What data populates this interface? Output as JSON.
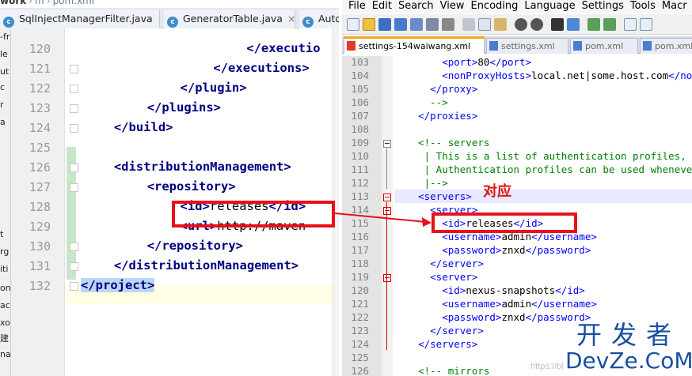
{
  "left": {
    "breadcrumb": [
      "work",
      "m",
      "pom.xml"
    ],
    "tabs": [
      "SqlInjectManagerFilter.java",
      "GeneratorTable.java",
      "Auto"
    ],
    "project_fragments": [
      "-fr",
      "le",
      "ut",
      "c",
      "r",
      "a",
      "t",
      "rg",
      "iti",
      "on",
      "ac",
      "xo",
      "建",
      "na"
    ],
    "line_numbers": [
      "120",
      "121",
      "122",
      "123",
      "124",
      "125",
      "126",
      "127",
      "128",
      "129",
      "130",
      "131",
      "132"
    ],
    "code_lines": [
      {
        "indent": 10,
        "text": "</executio",
        "kind": "tag"
      },
      {
        "indent": 8,
        "text": "</executions>",
        "kind": "tag"
      },
      {
        "indent": 6,
        "text": "</plugin>",
        "kind": "tag"
      },
      {
        "indent": 4,
        "text": "</plugins>",
        "kind": "tag"
      },
      {
        "indent": 2,
        "text": "</build>",
        "kind": "tag"
      },
      {
        "indent": 0,
        "text": "",
        "kind": "blank"
      },
      {
        "indent": 2,
        "text": "<distributionManagement>",
        "kind": "tag"
      },
      {
        "indent": 4,
        "text": "<repository>",
        "kind": "tag"
      },
      {
        "indent": 6,
        "open": "<id>",
        "value": "releases",
        "close": "</id>",
        "kind": "mixed"
      },
      {
        "indent": 6,
        "open": "<url>",
        "value": "http://maven",
        "close": "",
        "kind": "mixed"
      },
      {
        "indent": 4,
        "text": "</repository>",
        "kind": "tag"
      },
      {
        "indent": 2,
        "text": "</distributionManagement>",
        "kind": "tag"
      },
      {
        "indent": 0,
        "text": "</project>",
        "kind": "tag"
      }
    ]
  },
  "right": {
    "menu": [
      "File",
      "Edit",
      "Search",
      "View",
      "Encoding",
      "Language",
      "Settings",
      "Tools",
      "Macr"
    ],
    "tabs": [
      "settings-154waiwang.xml",
      "settings.xml",
      "pom.xml",
      "pom.xml"
    ],
    "line_numbers": [
      "103",
      "104",
      "105",
      "106",
      "107",
      "108",
      "109",
      "110",
      "111",
      "112",
      "113",
      "114",
      "115",
      "116",
      "117",
      "118",
      "119",
      "120",
      "121",
      "122",
      "123",
      "124",
      "125",
      "126"
    ],
    "code_lines": [
      [
        {
          "c": "nt",
          "t": "        <port>"
        },
        {
          "c": "ntx",
          "t": "80"
        },
        {
          "c": "nt",
          "t": "</port>"
        }
      ],
      [
        {
          "c": "nt",
          "t": "        <nonProxyHosts>"
        },
        {
          "c": "ntx",
          "t": "local.net|some.host.com"
        },
        {
          "c": "nt",
          "t": "</no"
        }
      ],
      [
        {
          "c": "nt",
          "t": "      </proxy>"
        }
      ],
      [
        {
          "c": "nc",
          "t": "      -->"
        }
      ],
      [
        {
          "c": "nt",
          "t": "    </proxies>"
        }
      ],
      [
        {
          "c": "ntx",
          "t": ""
        }
      ],
      [
        {
          "c": "nc",
          "t": "    <!-- servers"
        }
      ],
      [
        {
          "c": "nc",
          "t": "     | This is a list of authentication profiles,"
        }
      ],
      [
        {
          "c": "nc",
          "t": "     | Authentication profiles can be used wheneve"
        }
      ],
      [
        {
          "c": "nc",
          "t": "     |-->"
        }
      ],
      [
        {
          "c": "nt",
          "t": "    <servers>"
        }
      ],
      [
        {
          "c": "nt",
          "t": "      <server>"
        }
      ],
      [
        {
          "c": "nt",
          "t": "        <id>"
        },
        {
          "c": "ntx",
          "t": "releases"
        },
        {
          "c": "nt",
          "t": "</id>"
        }
      ],
      [
        {
          "c": "nt",
          "t": "        <username>"
        },
        {
          "c": "ntx",
          "t": "admin"
        },
        {
          "c": "nt",
          "t": "</username>"
        }
      ],
      [
        {
          "c": "nt",
          "t": "        <password>"
        },
        {
          "c": "ntx",
          "t": "znxd"
        },
        {
          "c": "nt",
          "t": "</password>"
        }
      ],
      [
        {
          "c": "nt",
          "t": "      </server>"
        }
      ],
      [
        {
          "c": "nt",
          "t": "      <server>"
        }
      ],
      [
        {
          "c": "nt",
          "t": "        <id>"
        },
        {
          "c": "ntx",
          "t": "nexus-snapshots"
        },
        {
          "c": "nt",
          "t": "</id>"
        }
      ],
      [
        {
          "c": "nt",
          "t": "        <username>"
        },
        {
          "c": "ntx",
          "t": "admin"
        },
        {
          "c": "nt",
          "t": "</username>"
        }
      ],
      [
        {
          "c": "nt",
          "t": "        <password>"
        },
        {
          "c": "ntx",
          "t": "znxd"
        },
        {
          "c": "nt",
          "t": "</password>"
        }
      ],
      [
        {
          "c": "nt",
          "t": "      </server>"
        }
      ],
      [
        {
          "c": "nt",
          "t": "    </servers>"
        }
      ],
      [
        {
          "c": "ntx",
          "t": ""
        }
      ],
      [
        {
          "c": "nc",
          "t": "    <!-- mirrors"
        }
      ]
    ]
  },
  "annotation": {
    "label": "对应",
    "color": "#e8101a"
  },
  "watermark": {
    "line1": "开发者",
    "line2": "DevZe.CoM",
    "faint": "https://bl"
  }
}
